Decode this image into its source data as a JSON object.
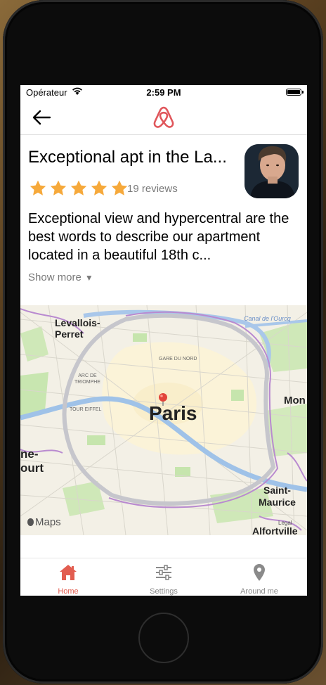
{
  "colors": {
    "brand": "#e0565b",
    "star": "#f6a93b",
    "muted": "#7a7a7a",
    "tab_active": "#e25d50",
    "tab_inactive": "#8a8a8a"
  },
  "status_bar": {
    "carrier": "Opérateur",
    "time": "2:59 PM"
  },
  "navbar": {
    "back_icon": "arrow-left-icon",
    "logo_icon": "airbnb-logo-icon"
  },
  "listing": {
    "title": "Exceptional apt in the La...",
    "rating": 5,
    "max_rating": 5,
    "reviews": "19 reviews",
    "description": "Exceptional view and hypercentral are the best words to describe our apartment located in a beautiful 18th c...",
    "show_more": "Show more"
  },
  "map": {
    "labels": {
      "city": "Paris",
      "levallois": "Levallois-\nPerret",
      "gare_du_nord": "GARE DU NORD",
      "arc": "ARC DE\nTRIOMPHE",
      "tour_eiffel": "TOUR EIFFEL",
      "canal": "Canal de l'Ourcq",
      "mont": "Mon",
      "boulogne": "ne-\nourt",
      "saint_maurice": "Saint-\nMaurice",
      "alfortville": "Alfortville",
      "legal": "Legal",
      "attribution": "Maps"
    }
  },
  "tabs": [
    {
      "label": "Home",
      "icon": "home-icon",
      "active": true
    },
    {
      "label": "Settings",
      "icon": "sliders-icon",
      "active": false
    },
    {
      "label": "Around me",
      "icon": "location-pin-icon",
      "active": false
    }
  ]
}
